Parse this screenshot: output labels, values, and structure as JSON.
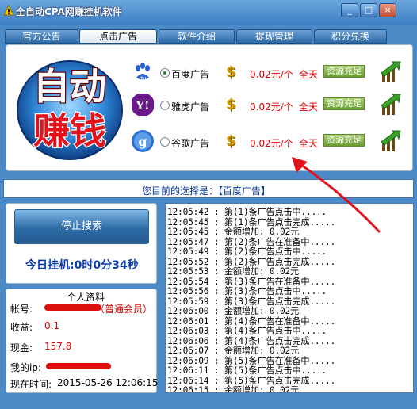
{
  "window": {
    "title": "全自动CPA网赚挂机软件"
  },
  "title_buttons": {
    "min": "_",
    "max": "□",
    "close": "×"
  },
  "tabs": [
    {
      "label": "官方公告",
      "active": false
    },
    {
      "label": "点击广告",
      "active": true
    },
    {
      "label": "软件介绍",
      "active": false
    },
    {
      "label": "提现管理",
      "active": false
    },
    {
      "label": "积分兑换",
      "active": false
    }
  ],
  "logo": {
    "line1": "自动",
    "line2": "赚钱"
  },
  "ads": [
    {
      "name": "百度广告",
      "price": "0.02元/个",
      "period": "全天",
      "action": "资源充足",
      "selected": true,
      "icon": "baidu-paw-icon"
    },
    {
      "name": "雅虎广告",
      "price": "0.02元/个",
      "period": "全天",
      "action": "资源充足",
      "selected": false,
      "icon": "yahoo-icon"
    },
    {
      "name": "谷歌广告",
      "price": "0.02元/个",
      "period": "全天",
      "action": "资源充足",
      "selected": false,
      "icon": "google-icon"
    }
  ],
  "coin_symbol": "$",
  "current_choice": "您目前的选择是：【百度广告】",
  "stop_button": "停止搜索",
  "online_time": "今日挂机:0时0分34秒",
  "profile": {
    "title": "个人资料",
    "account_label": "帐号:",
    "account_suffix": "（普通会员）",
    "income_label": "收益:",
    "income_value": "0.1",
    "cash_label": "现金:",
    "cash_value": "157.8",
    "ip_label": "我的ip:",
    "time_label": "现在时间:",
    "time_value": "2015-05-26 12:06:15"
  },
  "log": [
    "12:05:42 : 第(1)条广告点击中.....",
    "12:05:45 : 第(1)条广告点击完成.....",
    "12:05:45 : 金额增加: 0.02元",
    "12:05:47 : 第(2)条广告在准备中.....",
    "12:05:49 : 第(2)条广告点击中.....",
    "12:05:52 : 第(2)条广告点击完成.....",
    "12:05:53 : 金额增加: 0.02元",
    "12:05:54 : 第(3)条广告在准备中.....",
    "12:05:56 : 第(3)条广告点击中.....",
    "12:05:59 : 第(3)条广告点击完成.....",
    "12:06:00 : 金额增加: 0.02元",
    "12:06:01 : 第(4)条广告在准备中.....",
    "12:06:03 : 第(4)条广告点击中.....",
    "12:06:06 : 第(4)条广告点击完成.....",
    "12:06:07 : 金额增加: 0.02元",
    "12:06:09 : 第(5)条广告在准备中.....",
    "12:06:11 : 第(5)条广告点击中.....",
    "12:06:14 : 第(5)条广告点击完成.....",
    "12:06:15 : 金额增加: 0.02元"
  ],
  "colors": {
    "frame": "#4b8ac6",
    "price_red": "#e00000",
    "accent_blue": "#0a38b0",
    "annotation_red": "#e0141c"
  }
}
